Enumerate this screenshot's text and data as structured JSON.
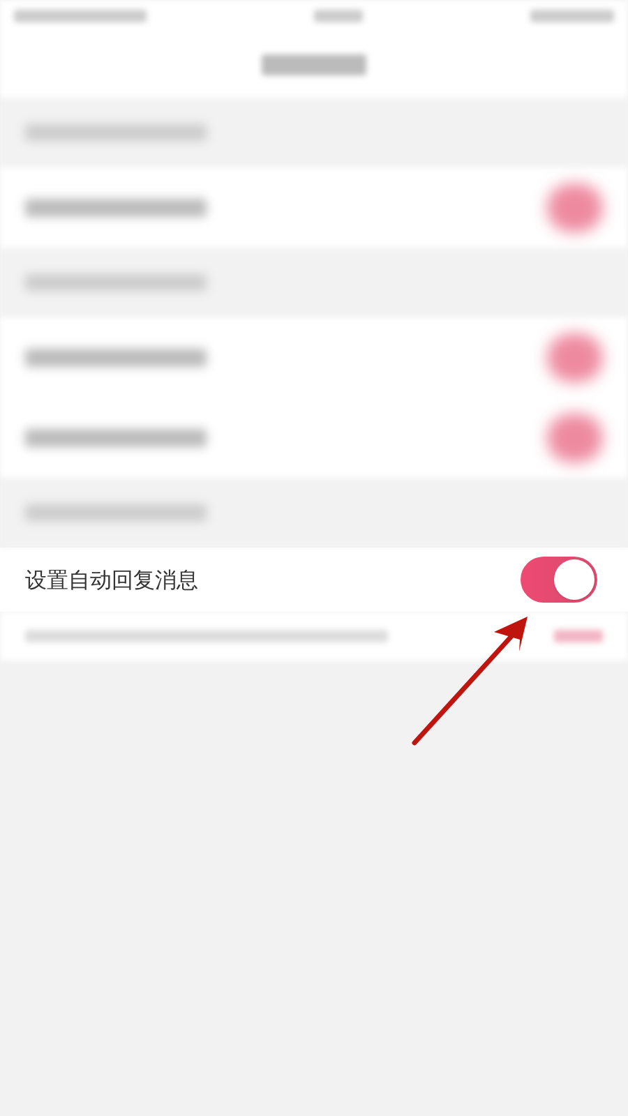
{
  "blurred_rows": [
    {
      "kind": "section"
    },
    {
      "kind": "toggle",
      "on": true
    },
    {
      "kind": "section"
    },
    {
      "kind": "toggle",
      "on": true
    },
    {
      "kind": "toggle",
      "on": true
    },
    {
      "kind": "section"
    }
  ],
  "auto_reply": {
    "label": "设置自动回复消息",
    "on": true
  },
  "annotation": {
    "kind": "arrow"
  }
}
